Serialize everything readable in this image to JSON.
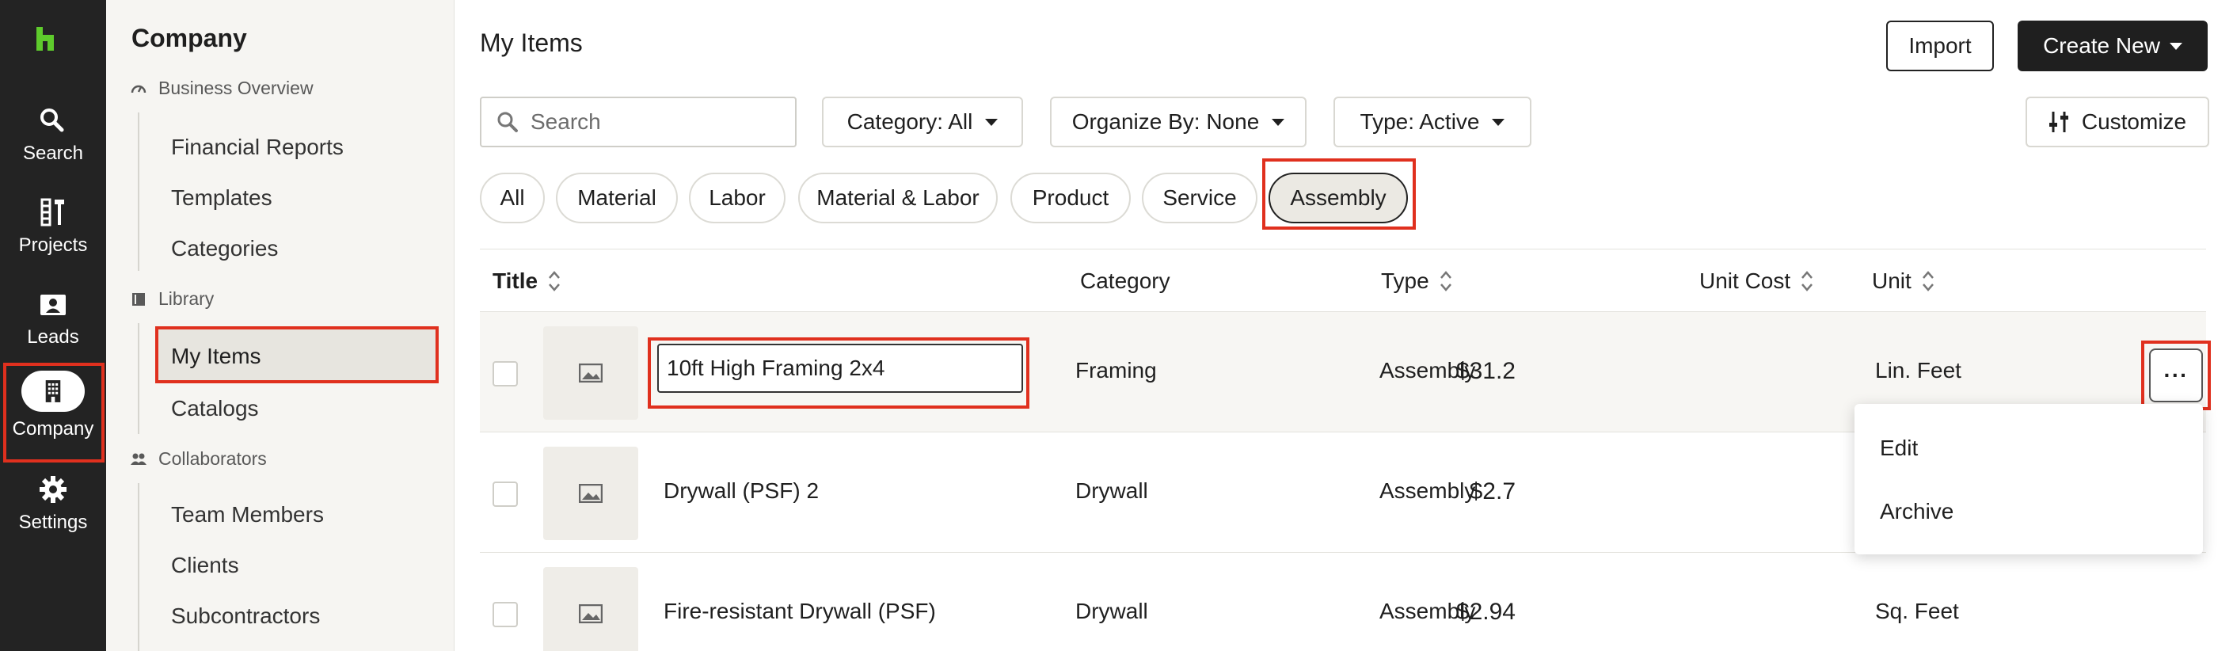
{
  "rail": {
    "items": [
      {
        "label": "Search",
        "icon": "search-icon"
      },
      {
        "label": "Projects",
        "icon": "projects-icon"
      },
      {
        "label": "Leads",
        "icon": "leads-icon"
      },
      {
        "label": "Company",
        "icon": "building-icon"
      },
      {
        "label": "Settings",
        "icon": "gear-icon"
      }
    ],
    "active": "Company"
  },
  "sidebar": {
    "title": "Company",
    "sections": [
      {
        "label": "Business Overview",
        "icon": "gauge-icon",
        "items": [
          "Financial Reports",
          "Templates",
          "Categories"
        ]
      },
      {
        "label": "Library",
        "icon": "book-icon",
        "items": [
          "My Items",
          "Catalogs"
        ]
      },
      {
        "label": "Collaborators",
        "icon": "people-icon",
        "items": [
          "Team Members",
          "Clients",
          "Subcontractors"
        ]
      }
    ],
    "selected": "My Items"
  },
  "header": {
    "title": "My Items",
    "import_label": "Import",
    "create_label": "Create New"
  },
  "toolbar": {
    "search_placeholder": "Search",
    "category_filter": "Category: All",
    "organize_filter": "Organize By: None",
    "type_filter": "Type: Active",
    "customize_label": "Customize"
  },
  "chips": [
    "All",
    "Material",
    "Labor",
    "Material & Labor",
    "Product",
    "Service",
    "Assembly"
  ],
  "active_chip": "Assembly",
  "table": {
    "columns": [
      "Title",
      "Category",
      "Type",
      "Unit Cost",
      "Unit"
    ],
    "rows": [
      {
        "title": "10ft High Framing 2x4",
        "category": "Framing",
        "type": "Assembly",
        "unit_cost": "$31.2",
        "unit": "Lin. Feet"
      },
      {
        "title": "Drywall (PSF) 2",
        "category": "Drywall",
        "type": "Assembly",
        "unit_cost": "$2.7",
        "unit": ""
      },
      {
        "title": "Fire-resistant Drywall (PSF)",
        "category": "Drywall",
        "type": "Assembly",
        "unit_cost": "$2.94",
        "unit": "Sq. Feet"
      }
    ]
  },
  "row_menu": {
    "more_label": "···",
    "items": [
      "Edit",
      "Archive"
    ]
  },
  "colors": {
    "rail_bg": "#232323",
    "brand_green": "#5ecb2c",
    "highlight_red": "#e0301e",
    "sidebar_bg": "#f6f5f2"
  }
}
